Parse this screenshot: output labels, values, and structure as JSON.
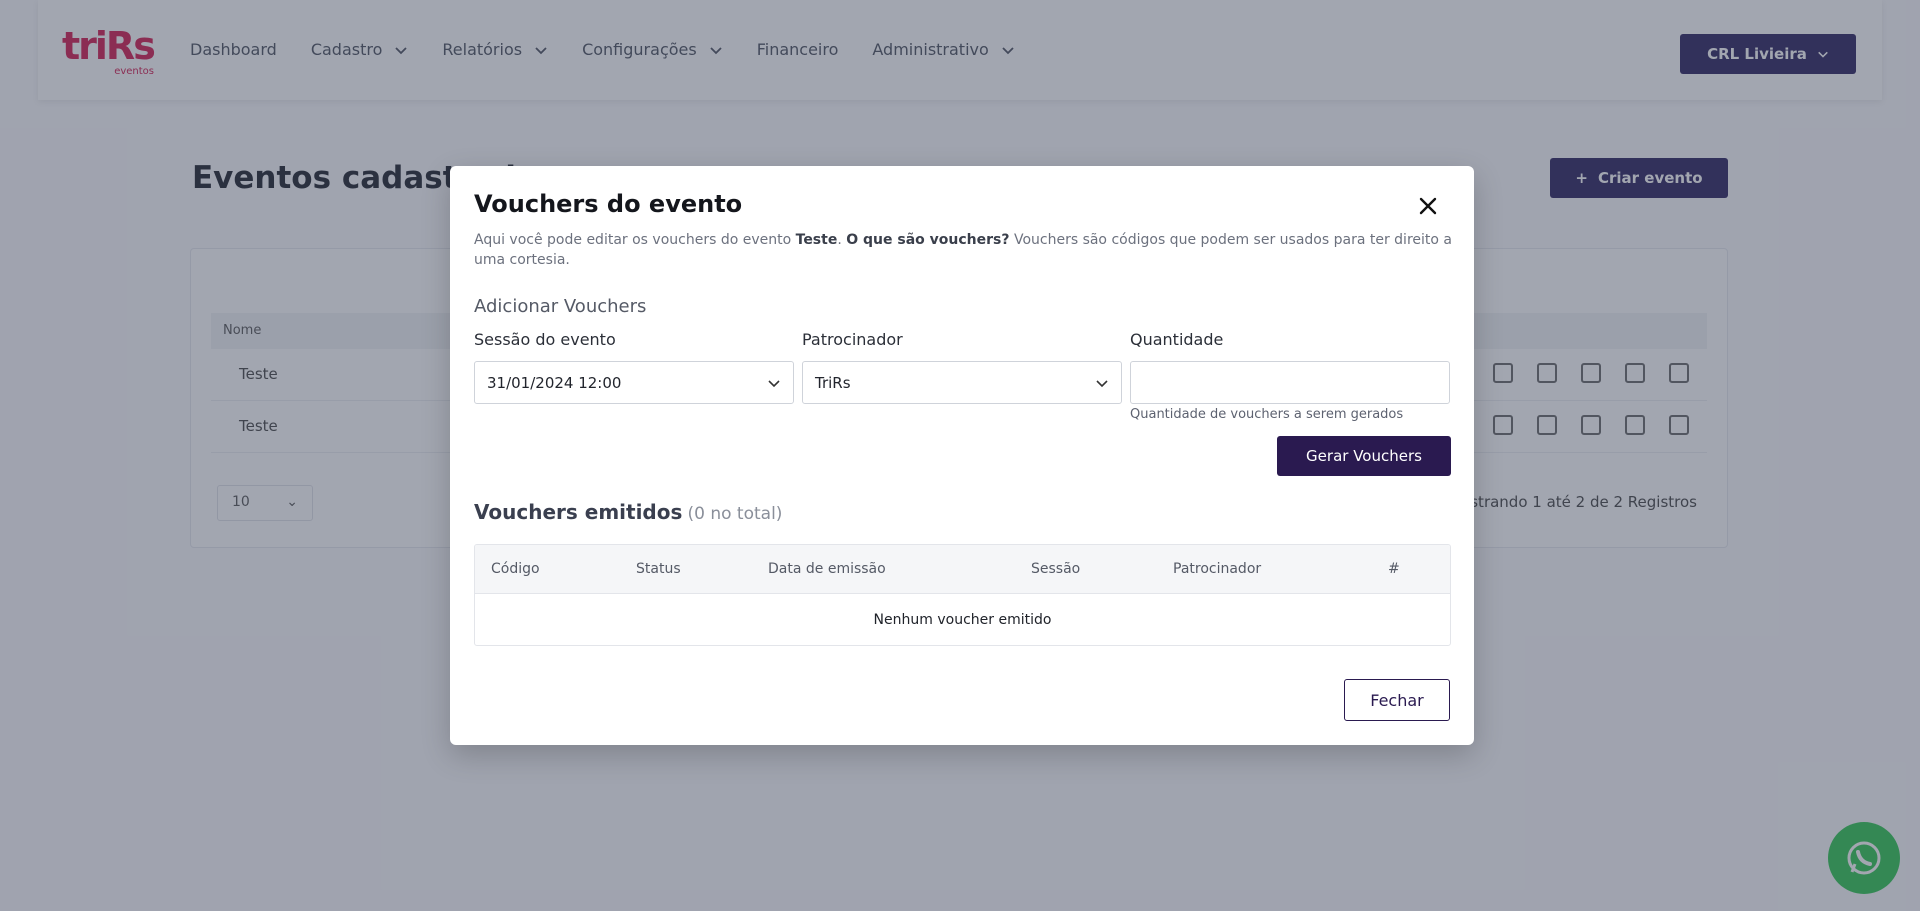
{
  "app": {
    "logo_text": "triRs",
    "logo_sub": "eventos",
    "nav": [
      "Dashboard",
      "Cadastro",
      "Relatórios",
      "Configurações",
      "Financeiro",
      "Administrativo"
    ],
    "user_label": "CRL Livieira"
  },
  "page": {
    "title": "Eventos cadastrados",
    "create_label": "Criar evento",
    "table_head": "Nome",
    "rows": [
      "Teste",
      "Teste"
    ],
    "page_size": "10",
    "count_text": "Mostrando 1 até 2 de 2 Registros"
  },
  "modal": {
    "title": "Vouchers do evento",
    "desc_prefix": "Aqui você pode editar os vouchers do evento ",
    "event_name": "Teste",
    "desc_mid": ". ",
    "question": "O que são vouchers?",
    "desc_suffix": " Vouchers são códigos que podem ser usados para ter direito a uma cortesia.",
    "add_section": "Adicionar Vouchers",
    "session_label": "Sessão do evento",
    "session_value": "31/01/2024 12:00",
    "sponsor_label": "Patrocinador",
    "sponsor_value": "TriRs",
    "qty_label": "Quantidade",
    "qty_value": "",
    "qty_help": "Quantidade de vouchers a serem gerados",
    "generate_label": "Gerar Vouchers",
    "issued_title": "Vouchers emitidos",
    "issued_count": "(0 no total)",
    "columns": [
      "Código",
      "Status",
      "Data de emissão",
      "Sessão",
      "Patrocinador",
      "#"
    ],
    "empty_text": "Nenhum voucher emitido",
    "close_label": "Fechar"
  },
  "colors": {
    "primary": "#2a1a50",
    "brand": "#d3184d",
    "whatsapp": "#2cc64f"
  }
}
